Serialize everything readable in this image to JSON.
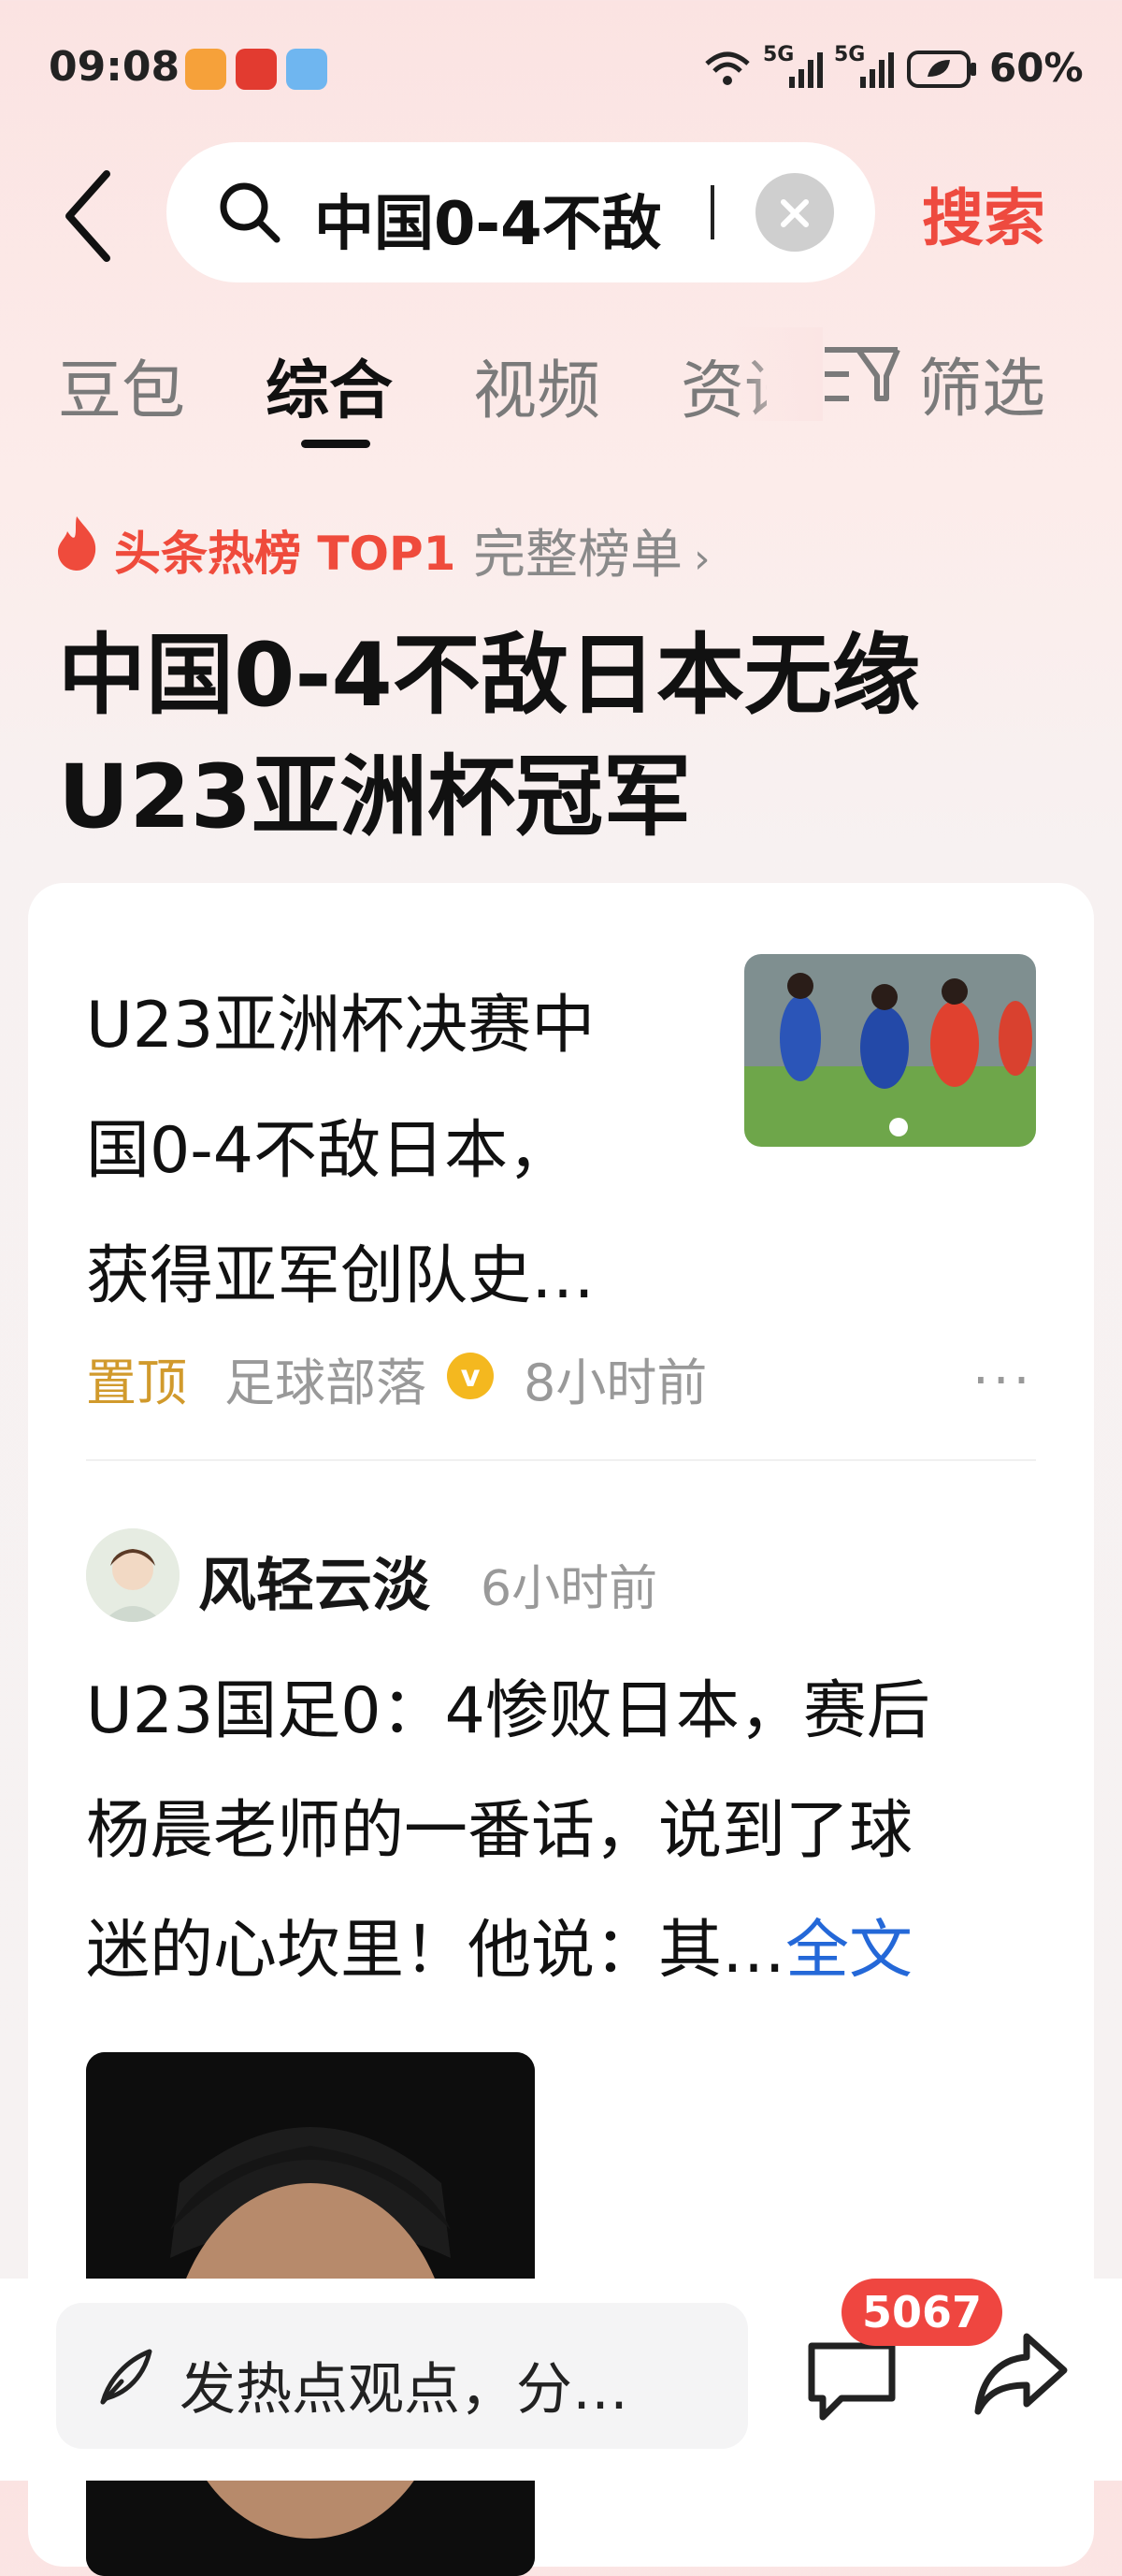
{
  "status_bar": {
    "time": "09:08",
    "network1": "5G",
    "network2": "5G",
    "battery": "60%"
  },
  "search": {
    "query": "中国0-4不敌",
    "button": "搜索"
  },
  "tabs": [
    {
      "label": "豆包"
    },
    {
      "label": "综合",
      "active": true
    },
    {
      "label": "视频"
    },
    {
      "label": "资讯"
    }
  ],
  "filter": {
    "label": "筛选"
  },
  "hot": {
    "badge": "头条热榜 TOP1",
    "full_list": "完整榜单",
    "title_line1": "中国0-4不敌日本无缘",
    "title_line2": "U23亚洲杯冠军"
  },
  "article1": {
    "title_line1": "U23亚洲杯决赛中",
    "title_line2": "国0-4不敌日本，",
    "title_line3": "获得亚军创队史…",
    "pin": "置顶",
    "source": "足球部落",
    "verified": "v",
    "age": "8小时前"
  },
  "article2": {
    "author": "风轻云淡",
    "age": "6小时前",
    "body_line1": "U23国足0：4惨败日本，赛后",
    "body_line2": "杨晨老师的一番话，说到了球",
    "body_line3": "迷的心坎里！他说：其…",
    "full_text": "全文"
  },
  "bottom_bar": {
    "placeholder": "发热点观点，分…",
    "comment_count": "5067"
  },
  "colors": {
    "accent": "#ee4a3f",
    "link": "#2468d8",
    "pin": "#d19a2c",
    "verified": "#f4b81f"
  }
}
